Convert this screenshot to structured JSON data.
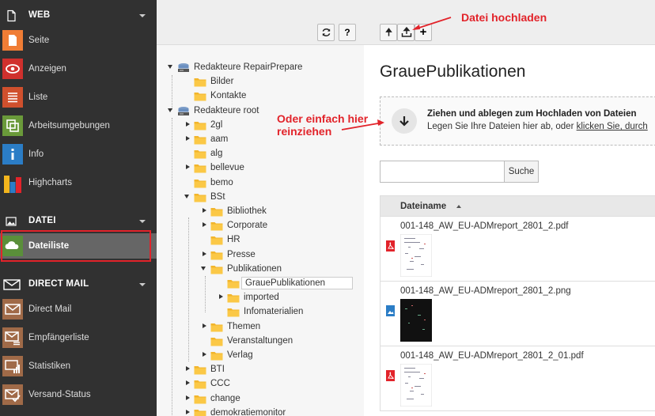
{
  "sidebar": {
    "groups": [
      {
        "label": "WEB",
        "icon": "page-icon",
        "modules": [
          {
            "label": "Seite",
            "icon": "page-module-icon",
            "color": "#f07d35"
          },
          {
            "label": "Anzeigen",
            "icon": "eye-icon",
            "color": "#d0302d"
          },
          {
            "label": "Liste",
            "icon": "list-icon",
            "color": "#d0502d"
          },
          {
            "label": "Arbeitsumgebungen",
            "icon": "workspaces-icon",
            "color": "#6a9a3a"
          },
          {
            "label": "Info",
            "icon": "info-icon",
            "color": "#2b7dc6"
          },
          {
            "label": "Highcharts",
            "icon": "highcharts-icon",
            "color": "#f3b51d"
          }
        ]
      },
      {
        "label": "DATEI",
        "icon": "image-icon",
        "modules": [
          {
            "label": "Dateiliste",
            "icon": "filelist-icon",
            "color": "#5a8f3a"
          }
        ]
      },
      {
        "label": "DIRECT MAIL",
        "icon": "mail-icon",
        "modules": [
          {
            "label": "Direct Mail",
            "icon": "envelope-icon",
            "color": "#a06a48"
          },
          {
            "label": "Empfängerliste",
            "icon": "recipients-icon",
            "color": "#a06a48"
          },
          {
            "label": "Statistiken",
            "icon": "statistics-icon",
            "color": "#a06a48"
          },
          {
            "label": "Versand-Status",
            "icon": "send-status-icon",
            "color": "#a06a48"
          }
        ]
      }
    ]
  },
  "tree": {
    "nodes": [
      {
        "label": "Redakteure RepairPrepare",
        "type": "mount",
        "state": "open"
      },
      {
        "label": "Bilder",
        "type": "folder",
        "state": "none"
      },
      {
        "label": "Kontakte",
        "type": "folder",
        "state": "none"
      },
      {
        "label": "Redakteure root",
        "type": "mount",
        "state": "open"
      },
      {
        "label": "2gl",
        "type": "folder",
        "state": "closed"
      },
      {
        "label": "aam",
        "type": "folder",
        "state": "closed"
      },
      {
        "label": "alg",
        "type": "folder",
        "state": "none"
      },
      {
        "label": "bellevue",
        "type": "folder",
        "state": "closed"
      },
      {
        "label": "bemo",
        "type": "folder",
        "state": "none"
      },
      {
        "label": "BSt",
        "type": "folder",
        "state": "open"
      },
      {
        "label": "Bibliothek",
        "type": "folder",
        "state": "closed"
      },
      {
        "label": "Corporate",
        "type": "folder",
        "state": "closed"
      },
      {
        "label": "HR",
        "type": "folder",
        "state": "none"
      },
      {
        "label": "Presse",
        "type": "folder",
        "state": "closed"
      },
      {
        "label": "Publikationen",
        "type": "folder",
        "state": "open"
      },
      {
        "label": "GrauePublikationen",
        "type": "folder",
        "state": "none",
        "selected": true
      },
      {
        "label": "imported",
        "type": "folder",
        "state": "closed"
      },
      {
        "label": "Infomaterialien",
        "type": "folder",
        "state": "none"
      },
      {
        "label": "Themen",
        "type": "folder",
        "state": "closed"
      },
      {
        "label": "Veranstaltungen",
        "type": "folder",
        "state": "none"
      },
      {
        "label": "Verlag",
        "type": "folder",
        "state": "closed"
      },
      {
        "label": "BTI",
        "type": "folder",
        "state": "closed"
      },
      {
        "label": "CCC",
        "type": "folder",
        "state": "closed"
      },
      {
        "label": "change",
        "type": "folder",
        "state": "closed"
      },
      {
        "label": "demokratiemonitor",
        "type": "folder",
        "state": "closed"
      }
    ]
  },
  "toolbar": {
    "refresh_icon": "refresh-icon",
    "help_label": "?",
    "folder_up_icon": "folder-up-icon",
    "upload_icon": "upload-icon",
    "new_label": "+"
  },
  "main": {
    "title": "GrauePublikationen",
    "dropzone": {
      "title": "Ziehen und ablegen zum Hochladen von Dateien",
      "subtitle": "Legen Sie Ihre Dateien hier ab, oder ",
      "link": "klicken Sie, durch"
    },
    "search": {
      "placeholder": "",
      "button": "Suche"
    },
    "table": {
      "column": "Dateiname",
      "rows": [
        {
          "name": "001-148_AW_EU-ADMreport_2801_2.pdf",
          "type": "pdf"
        },
        {
          "name": "001-148_AW_EU-ADMreport_2801_2.png",
          "type": "png"
        },
        {
          "name": "001-148_AW_EU-ADMreport_2801_2_01.pdf",
          "type": "pdf"
        }
      ]
    }
  },
  "annotations": {
    "upload": "Datei hochladen",
    "drag_line1": "Oder einfach hier",
    "drag_line2": "reinziehen",
    "color": "#e2232a"
  }
}
